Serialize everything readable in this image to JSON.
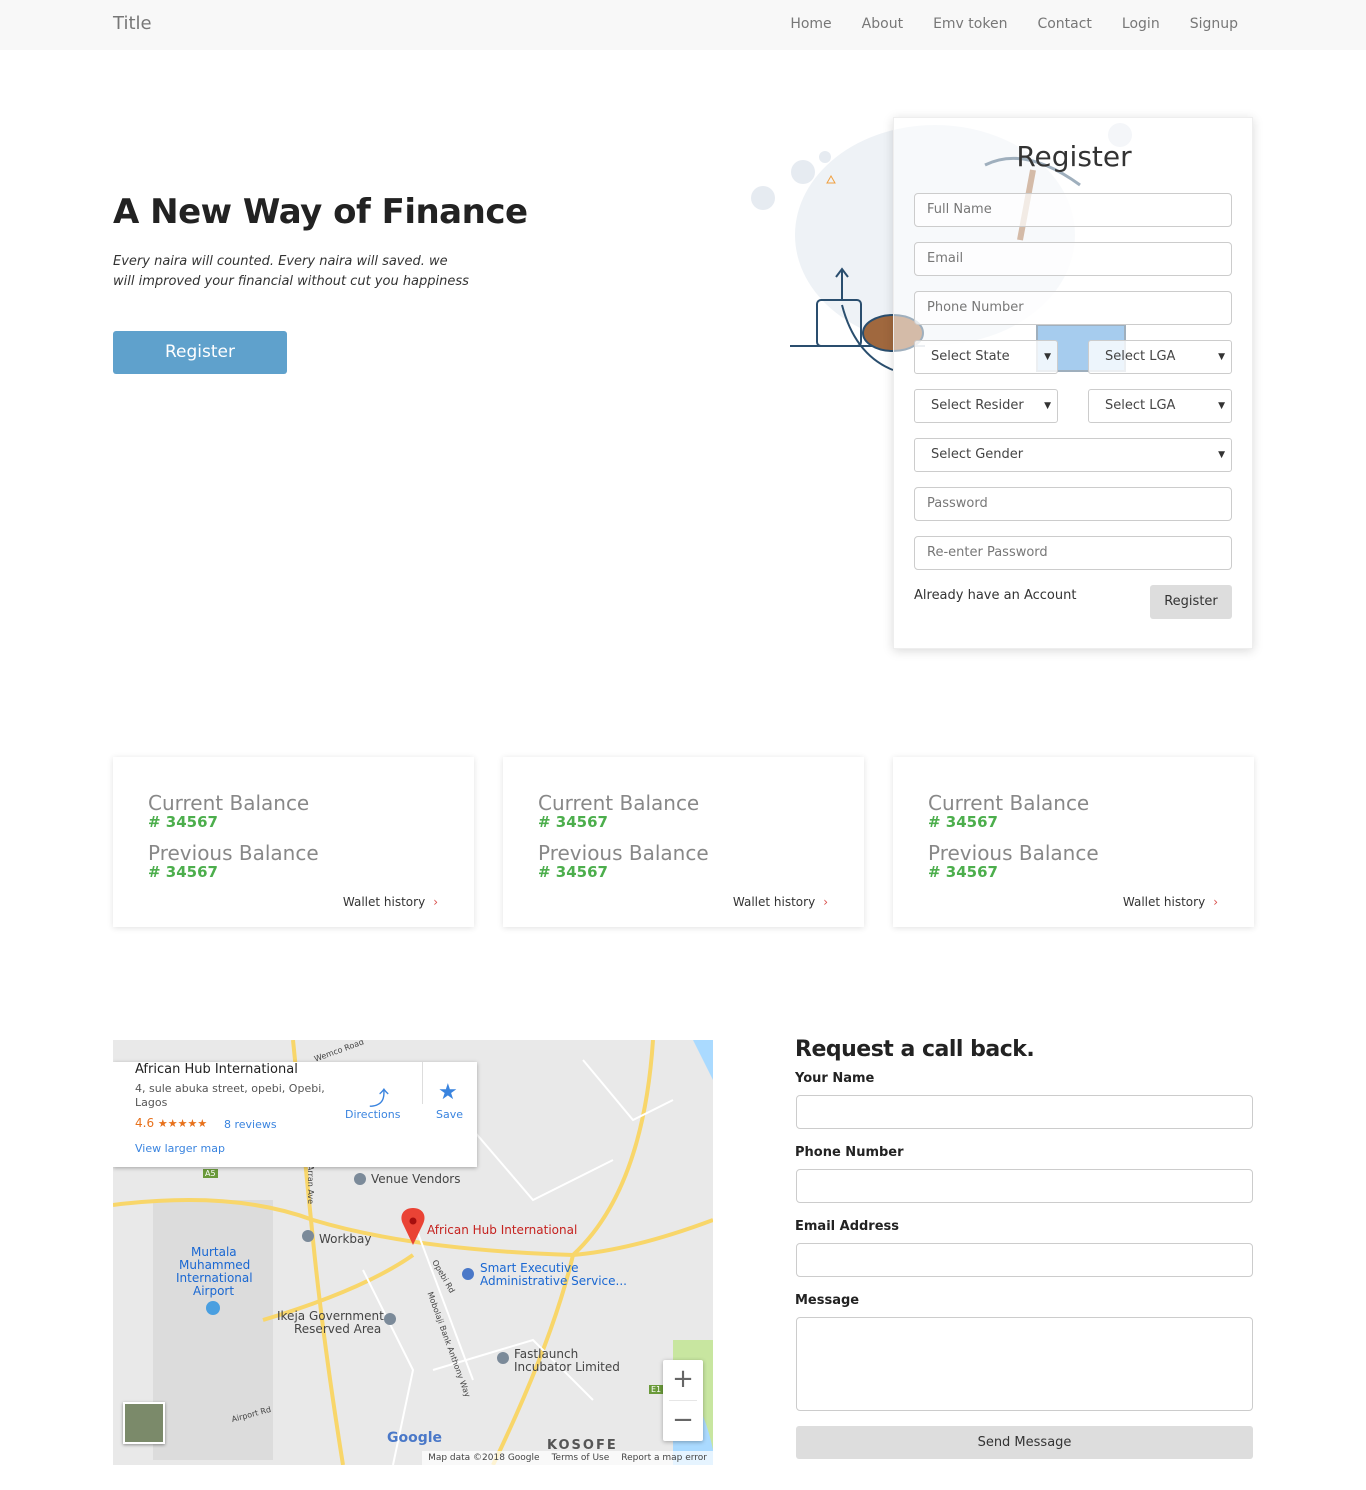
{
  "nav": {
    "brand": "Title",
    "links": [
      "Home",
      "About",
      "Emv token",
      "Contact",
      "Login",
      "Signup"
    ]
  },
  "hero": {
    "title": "A New Way of Finance",
    "subtitle": "Every naira will counted. Every naira will saved. we will improved your financial without cut you happiness",
    "button": "Register"
  },
  "register": {
    "title": "Register",
    "full_name_placeholder": "Full Name",
    "email_placeholder": "Email",
    "phone_placeholder": "Phone Number",
    "select_state": "Select State",
    "select_lga_1": "Select LGA",
    "select_resident": "Select Resider",
    "select_lga_2": "Select LGA",
    "select_gender": "Select Gender",
    "password_placeholder": "Password",
    "reenter_placeholder": "Re-enter Password",
    "already": "Already have an Account",
    "submit": "Register"
  },
  "balances": [
    {
      "current_label": "Current Balance",
      "current_value": "# 34567",
      "previous_label": "Previous Balance",
      "previous_value": "# 34567",
      "wallet": "Wallet history"
    },
    {
      "current_label": "Current Balance",
      "current_value": "# 34567",
      "previous_label": "Previous Balance",
      "previous_value": "# 34567",
      "wallet": "Wallet history"
    },
    {
      "current_label": "Current Balance",
      "current_value": "# 34567",
      "previous_label": "Previous Balance",
      "previous_value": "# 34567",
      "wallet": "Wallet history"
    }
  ],
  "map": {
    "place_name": "African Hub International",
    "address": "4, sule abuka street, opebi, Opebi, Lagos",
    "rating": "4.6",
    "stars": "★★★★★",
    "reviews": "8 reviews",
    "view_larger": "View larger map",
    "directions": "Directions",
    "save": "Save",
    "labels": {
      "venue_vendors": "Venue Vendors",
      "workbay": "Workbay",
      "pin_label": "African Hub International",
      "smart_exec_1": "Smart Executive",
      "smart_exec_2": "Administrative Service...",
      "airport_1": "Murtala",
      "airport_2": "Muhammed",
      "airport_3": "International",
      "airport_4": "Airport",
      "ikeja_1": "Ikeja Government",
      "ikeja_2": "Reserved Area",
      "fastlaunch_1": "Fastlaunch",
      "fastlaunch_2": "Incubator Limited",
      "kosofe": "KOSOFE",
      "wemco": "Wemco Road",
      "opebi_rd": "Opebi Rd",
      "mobolaji": "Mobolaji Bank Anthony Way",
      "airport_rd": "Airport Rd",
      "arran": "Arran Ave",
      "a5": "A5",
      "e1": "E1"
    },
    "google": "Google",
    "map_data": "Map data ©2018 Google",
    "terms": "Terms of Use",
    "report": "Report a map error"
  },
  "callback": {
    "title": "Request a call back.",
    "name_label": "Your Name",
    "phone_label": "Phone Number",
    "email_label": "Email Address",
    "message_label": "Message",
    "send": "Send Message"
  },
  "colors": {
    "accent_button": "#5fa1cc",
    "balance_green": "#4cae4c",
    "chevron_red": "#d9534f",
    "link_blue": "#3a84df"
  }
}
